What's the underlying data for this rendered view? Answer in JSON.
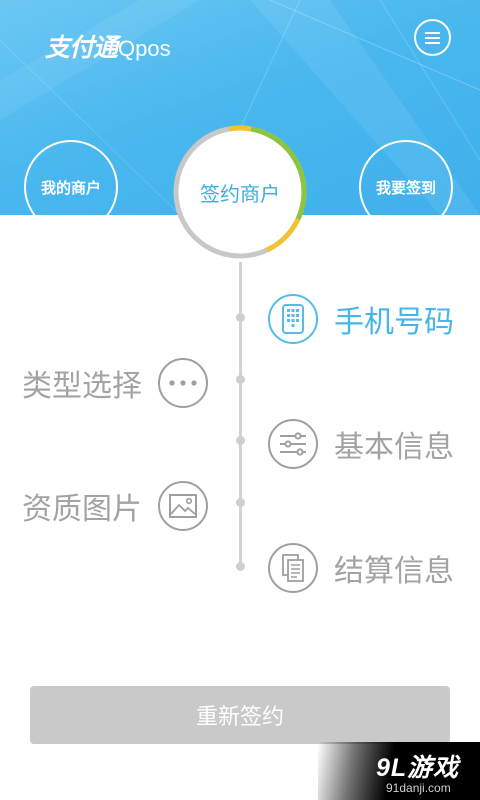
{
  "header": {
    "logo_cn": "支付通",
    "logo_en": "Qpos",
    "menu_icon": "hamburger-menu-icon"
  },
  "nav": {
    "my_merchants": "我的商户",
    "center": "签约商户",
    "check_in": "我要签到"
  },
  "steps": {
    "phone": {
      "label": "手机号码",
      "icon": "phone-keypad-icon"
    },
    "type": {
      "label": "类型选择",
      "icon": "more-dots-icon"
    },
    "basic": {
      "label": "基本信息",
      "icon": "sliders-icon"
    },
    "qualification": {
      "label": "资质图片",
      "icon": "image-icon"
    },
    "settlement": {
      "label": "结算信息",
      "icon": "documents-icon"
    }
  },
  "actions": {
    "resign": "重新签约"
  },
  "watermark": {
    "main": "9L游戏",
    "sub": "91danji.com"
  },
  "colors": {
    "header_blue": "#4ab8ef",
    "accent": "#44b6e8",
    "ring_green": "#8cc63f",
    "ring_yellow": "#f4c430",
    "button_gray": "#c9c9c9"
  }
}
